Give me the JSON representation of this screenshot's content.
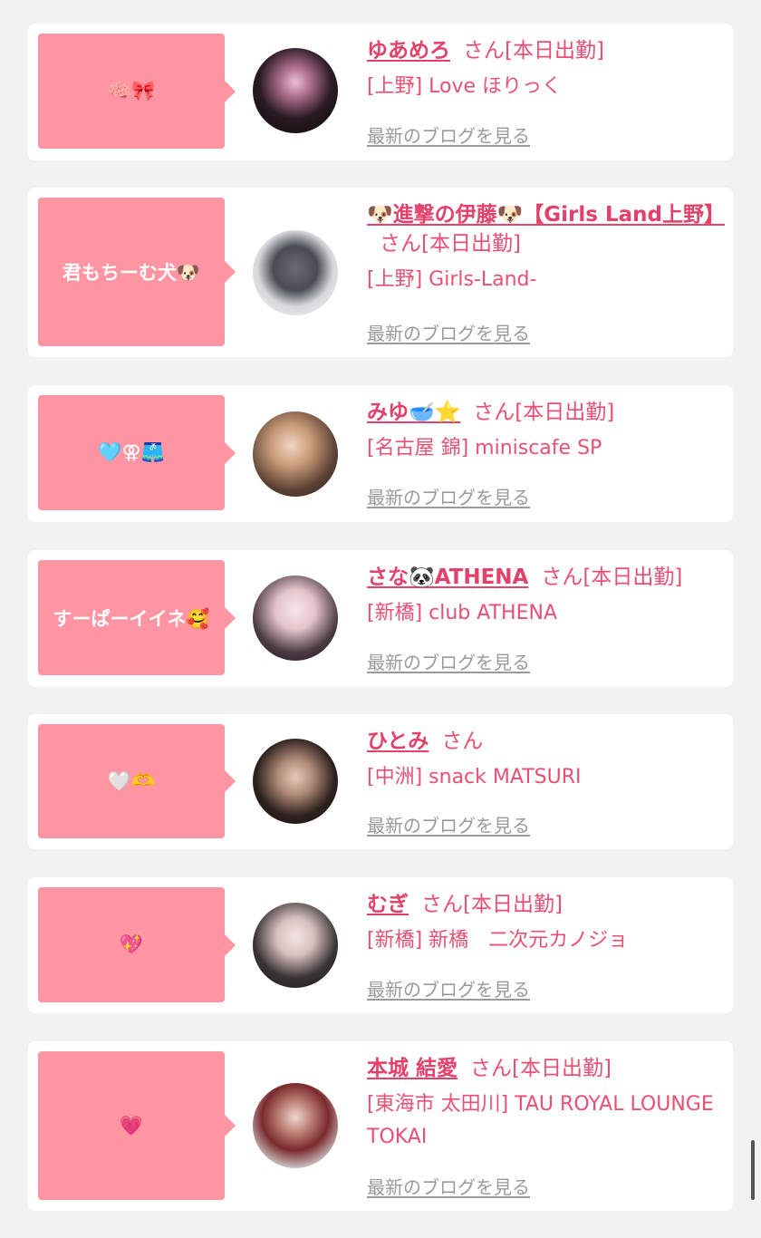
{
  "cards": [
    {
      "bubble": "🧠🎀",
      "name": "ゆあめろ",
      "suffix": "さん[本日出勤]",
      "shop": "[上野] Love ほりっく",
      "blog": "最新のブログを見る"
    },
    {
      "bubble": "君もちーむ犬🐶",
      "name": "🐶進撃の伊藤🐶【Girls Land上野】",
      "suffix": "さん[本日出勤]",
      "shop": "[上野] Girls-Land-",
      "blog": "最新のブログを見る"
    },
    {
      "bubble": "🩵⚢🩳",
      "name": "みゆ🥣⭐️",
      "suffix": "さん[本日出勤]",
      "shop": "[名古屋 錦] miniscafe SP",
      "blog": "最新のブログを見る"
    },
    {
      "bubble": "すーぱーイイネ🥰",
      "name": "さな🐼ATHENA",
      "suffix": "さん[本日出勤]",
      "shop": "[新橋] club ATHENA",
      "blog": "最新のブログを見る"
    },
    {
      "bubble": "🤍🫶",
      "name": "ひとみ",
      "suffix": "さん",
      "shop": "[中洲] snack MATSURI",
      "blog": "最新のブログを見る"
    },
    {
      "bubble": "💖",
      "name": "むぎ",
      "suffix": "さん[本日出勤]",
      "shop": "[新橋] 新橋　二次元カノジョ",
      "blog": "最新のブログを見る"
    },
    {
      "bubble": "💗",
      "name": "本城 結愛",
      "suffix": "さん[本日出勤]",
      "shop": "[東海市 太田川] TAU ROYAL LOUNGE TOKAI",
      "blog": "最新のブログを見る"
    }
  ],
  "colors": {
    "accent": "#e3406a",
    "bubble": "#ff94a2",
    "link_gray": "#9a9a9a",
    "background": "#f2f2f3"
  }
}
